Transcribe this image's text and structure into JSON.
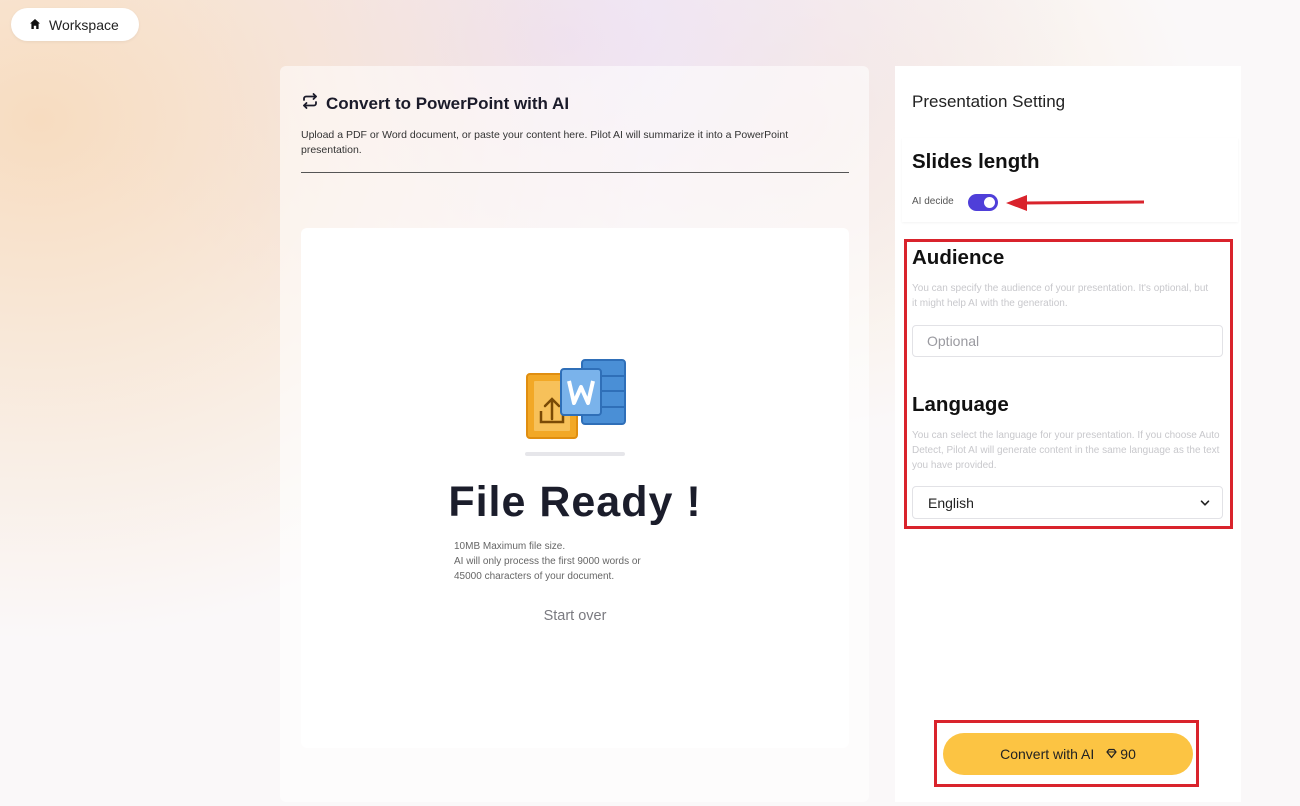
{
  "top": {
    "workspace_label": "Workspace"
  },
  "main": {
    "title": "Convert to PowerPoint with AI",
    "description": "Upload a PDF or Word document, or paste your content here. Pilot AI will summarize it into a PowerPoint presentation.",
    "file_ready": "File Ready !",
    "notes": [
      "10MB Maximum file size.",
      "AI will only process the first 9000 words or",
      "45000 characters of your document."
    ],
    "start_over": "Start over"
  },
  "settings": {
    "title": "Presentation Setting",
    "slides_length": {
      "title": "Slides length",
      "toggle_label": "AI decide",
      "toggle_on": true
    },
    "audience": {
      "title": "Audience",
      "description": "You can specify the audience of your presentation. It's optional, but it might help AI with the generation.",
      "placeholder": "Optional"
    },
    "language": {
      "title": "Language",
      "description": "You can select the language for your presentation. If you choose Auto Detect, Pilot AI will generate content in the same language as the text you have provided.",
      "selected": "English"
    },
    "convert": {
      "label": "Convert with AI",
      "credits": "90"
    }
  },
  "colors": {
    "accent": "#4f3fd9",
    "button": "#fcc443",
    "annotation_red": "#d9232c",
    "word_blue": "#4a8fd6",
    "upload_orange": "#f2a826"
  }
}
